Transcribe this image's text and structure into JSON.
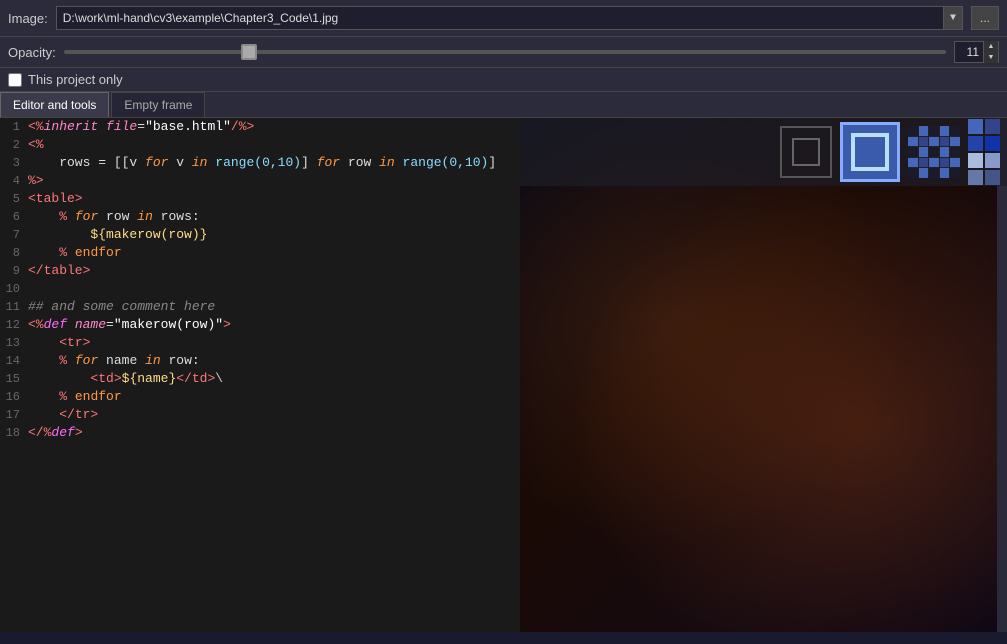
{
  "topbar": {
    "image_label": "Image:",
    "image_path": "D:\\work\\ml-hand\\cv3\\example\\Chapter3_Code\\1.jpg",
    "more_btn_label": "...",
    "dropdown_char": "▼"
  },
  "opacity": {
    "label": "Opacity:",
    "value": "11",
    "spin_up": "▲",
    "spin_down": "▼"
  },
  "checkbox": {
    "label": "This project only"
  },
  "tabs": {
    "active": "Editor and tools",
    "inactive": "Empty frame"
  },
  "code_lines": [
    {
      "num": "1",
      "html": "<span class='hl-tag'>&lt;%</span><span class='hl-attr-name'>inherit</span> <span class='hl-attr-name'>file</span>=<span class='hl-attr-val'>\"base.html\"</span><span class='hl-tag'>/%&gt;</span>"
    },
    {
      "num": "2",
      "html": "<span class='hl-tag'>&lt;%</span>"
    },
    {
      "num": "3",
      "html": "    rows = [[v <span class='kw-for'>for</span> v <span class='kw-in'>in</span> <span class='kw-range'>range(0,10)</span>] <span class='kw-for'>for</span> row <span class='kw-in'>in</span> <span class='kw-range'>range(0,10)</span>]"
    },
    {
      "num": "4",
      "html": "<span class='hl-tag'>%&gt;</span>"
    },
    {
      "num": "5",
      "html": "<span class='hl-tag'>&lt;table&gt;</span>"
    },
    {
      "num": "6",
      "html": "    <span class='hl-tag'>%</span> <span class='kw-for'>for</span> row <span class='kw-in'>in</span> rows:"
    },
    {
      "num": "7",
      "html": "        <span class='kw-var'>${makerow(row)}</span>"
    },
    {
      "num": "8",
      "html": "    <span class='hl-tag'>%</span> <span class='kw-endfor'>endfor</span>"
    },
    {
      "num": "9",
      "html": "<span class='hl-tag'>&lt;/table&gt;</span>"
    },
    {
      "num": "10",
      "html": ""
    },
    {
      "num": "11",
      "html": "<span class='kw-comment'>## and some comment here</span>"
    },
    {
      "num": "12",
      "html": "<span class='hl-tag'>&lt;%</span><span class='kw-def'>def</span> <span class='hl-attr-name'>name</span>=<span class='hl-attr-val'>\"makerow(row)\"</span><span class='hl-tag'>&gt;</span>"
    },
    {
      "num": "13",
      "html": "    <span class='hl-tag'>&lt;tr&gt;</span>"
    },
    {
      "num": "14",
      "html": "    <span class='hl-tag'>%</span> <span class='kw-for'>for</span> name <span class='kw-in'>in</span> row:"
    },
    {
      "num": "15",
      "html": "        <span class='hl-tag'>&lt;td&gt;</span><span class='kw-var'>${name}</span><span class='hl-tag'>&lt;/td&gt;</span><span class='hl-plain'>\\</span>"
    },
    {
      "num": "16",
      "html": "    <span class='hl-tag'>%</span> <span class='kw-endfor'>endfor</span>"
    },
    {
      "num": "17",
      "html": "    <span class='hl-tag'>&lt;/tr&gt;</span>"
    },
    {
      "num": "18",
      "html": "<span class='hl-tag'>&lt;/%</span><span class='kw-def'>def</span><span class='hl-tag'>&gt;</span>"
    }
  ],
  "swatch_colors": [
    "#4466bb",
    "#334488",
    "#2244aa",
    "#1133aa",
    "#aabbdd",
    "#8899cc",
    "#6677aa",
    "#445588"
  ],
  "preview": {
    "active_box_bg": "#3a5aaa",
    "active_box_border": "#88aaff"
  }
}
